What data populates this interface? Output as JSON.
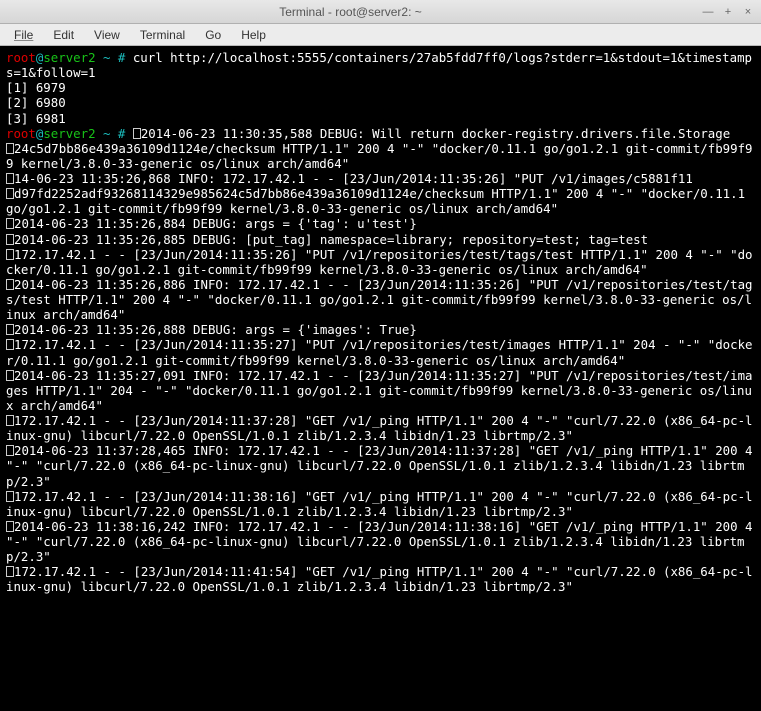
{
  "window": {
    "title": "Terminal - root@server2: ~"
  },
  "menu": {
    "items": [
      "File",
      "Edit",
      "View",
      "Terminal",
      "Go",
      "Help"
    ]
  },
  "prompt": {
    "user": "root",
    "at": "@",
    "host": "server2",
    "path": " ~ # "
  },
  "cmd1": "curl http://localhost:5555/containers/27ab5fdd7ff0/logs?stderr=1&stdout=1&timestamps=1&follow=1",
  "jobs": [
    "[1] 6979",
    "[2] 6980",
    "[3] 6981"
  ],
  "log": {
    "l0": "2014-06-23 11:30:35,588 DEBUG: Will return docker-registry.drivers.file.Storage",
    "l1": "24c5d7bb86e439a36109d1124e/checksum HTTP/1.1\" 200 4 \"-\" \"docker/0.11.1 go/go1.2.1 git-commit/fb99f99 kernel/3.8.0-33-generic os/linux arch/amd64\"",
    "l2": "14-06-23 11:35:26,868 INFO: 172.17.42.1 - - [23/Jun/2014:11:35:26] \"PUT /v1/images/c5881f11",
    "l3": "d97fd2252adf93268114329e985624c5d7bb86e439a36109d1124e/checksum HTTP/1.1\" 200 4 \"-\" \"docker/0.11.1 go/go1.2.1 git-commit/fb99f99 kernel/3.8.0-33-generic os/linux arch/amd64\"",
    "l4": "2014-06-23 11:35:26,884 DEBUG: args = {'tag': u'test'}",
    "l5": "2014-06-23 11:35:26,885 DEBUG: [put_tag] namespace=library; repository=test; tag=test",
    "l6": "172.17.42.1 - - [23/Jun/2014:11:35:26] \"PUT /v1/repositories/test/tags/test HTTP/1.1\" 200 4 \"-\" \"docker/0.11.1 go/go1.2.1 git-commit/fb99f99 kernel/3.8.0-33-generic os/linux arch/amd64\"",
    "l7": "2014-06-23 11:35:26,886 INFO: 172.17.42.1 - - [23/Jun/2014:11:35:26] \"PUT /v1/repositories/test/tags/test HTTP/1.1\" 200 4 \"-\" \"docker/0.11.1 go/go1.2.1 git-commit/fb99f99 kernel/3.8.0-33-generic os/linux arch/amd64\"",
    "l8": "2014-06-23 11:35:26,888 DEBUG: args = {'images': True}",
    "l9": "172.17.42.1 - - [23/Jun/2014:11:35:27] \"PUT /v1/repositories/test/images HTTP/1.1\" 204 - \"-\" \"docker/0.11.1 go/go1.2.1 git-commit/fb99f99 kernel/3.8.0-33-generic os/linux arch/amd64\"",
    "l10": "2014-06-23 11:35:27,091 INFO: 172.17.42.1 - - [23/Jun/2014:11:35:27] \"PUT /v1/repositories/test/images HTTP/1.1\" 204 - \"-\" \"docker/0.11.1 go/go1.2.1 git-commit/fb99f99 kernel/3.8.0-33-generic os/linux arch/amd64\"",
    "l11": "172.17.42.1 - - [23/Jun/2014:11:37:28] \"GET /v1/_ping HTTP/1.1\" 200 4 \"-\" \"curl/7.22.0 (x86_64-pc-linux-gnu) libcurl/7.22.0 OpenSSL/1.0.1 zlib/1.2.3.4 libidn/1.23 librtmp/2.3\"",
    "l12": "2014-06-23 11:37:28,465 INFO: 172.17.42.1 - - [23/Jun/2014:11:37:28] \"GET /v1/_ping HTTP/1.1\" 200 4 \"-\" \"curl/7.22.0 (x86_64-pc-linux-gnu) libcurl/7.22.0 OpenSSL/1.0.1 zlib/1.2.3.4 libidn/1.23 librtmp/2.3\"",
    "l13": "172.17.42.1 - - [23/Jun/2014:11:38:16] \"GET /v1/_ping HTTP/1.1\" 200 4 \"-\" \"curl/7.22.0 (x86_64-pc-linux-gnu) libcurl/7.22.0 OpenSSL/1.0.1 zlib/1.2.3.4 libidn/1.23 librtmp/2.3\"",
    "l14": "2014-06-23 11:38:16,242 INFO: 172.17.42.1 - - [23/Jun/2014:11:38:16] \"GET /v1/_ping HTTP/1.1\" 200 4 \"-\" \"curl/7.22.0 (x86_64-pc-linux-gnu) libcurl/7.22.0 OpenSSL/1.0.1 zlib/1.2.3.4 libidn/1.23 librtmp/2.3\"",
    "l15": "172.17.42.1 - - [23/Jun/2014:11:41:54] \"GET /v1/_ping HTTP/1.1\" 200 4 \"-\" \"curl/7.22.0 (x86_64-pc-linux-gnu) libcurl/7.22.0 OpenSSL/1.0.1 zlib/1.2.3.4 libidn/1.23 librtmp/2.3\""
  }
}
